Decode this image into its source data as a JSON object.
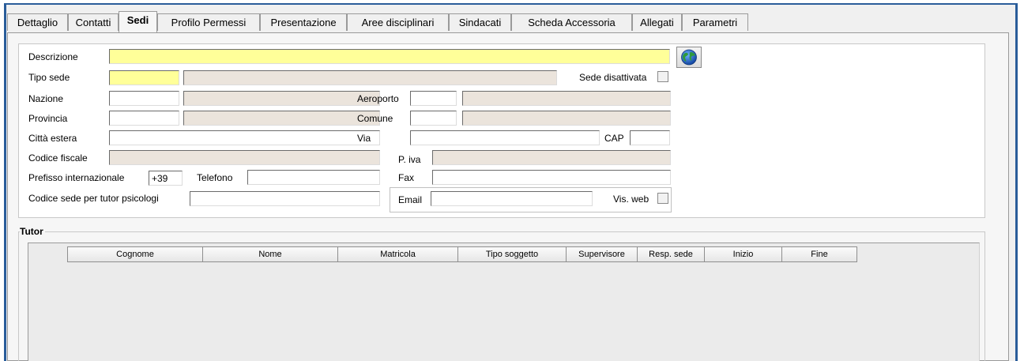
{
  "tabs": [
    {
      "label": "Dettaglio"
    },
    {
      "label": "Contatti"
    },
    {
      "label": "Sedi"
    },
    {
      "label": "Profilo Permessi"
    },
    {
      "label": "Presentazione"
    },
    {
      "label": "Aree disciplinari"
    },
    {
      "label": "Sindacati"
    },
    {
      "label": "Scheda Accessoria"
    },
    {
      "label": "Allegati"
    },
    {
      "label": "Parametri"
    }
  ],
  "active_tab": "Sedi",
  "form": {
    "descrizione_label": "Descrizione",
    "descrizione_value": "",
    "tipo_sede_label": "Tipo sede",
    "sede_disattivata_label": "Sede disattivata",
    "nazione_label": "Nazione",
    "aeroporto_label": "Aeroporto",
    "provincia_label": "Provincia",
    "comune_label": "Comune",
    "citta_estera_label": "Città estera",
    "via_label": "Via",
    "cap_label": "CAP",
    "codice_fiscale_label": "Codice fiscale",
    "piva_label": "P. iva",
    "prefisso_label": "Prefisso internazionale",
    "prefisso_value": "+39",
    "telefono_label": "Telefono",
    "fax_label": "Fax",
    "codice_tutor_label": "Codice sede per tutor psicologi",
    "email_label": "Email",
    "vis_web_label": "Vis. web"
  },
  "tutor": {
    "title": "Tutor",
    "columns": [
      "Cognome",
      "Nome",
      "Matricola",
      "Tipo soggetto",
      "Supervisore",
      "Resp. sede",
      "Inizio",
      "Fine"
    ]
  },
  "colors": {
    "required_field": "#ffff99",
    "readonly_field": "#ebe4dc",
    "window_border": "#2a5d9a"
  },
  "icons": {
    "globe_button": "globe-icon"
  }
}
